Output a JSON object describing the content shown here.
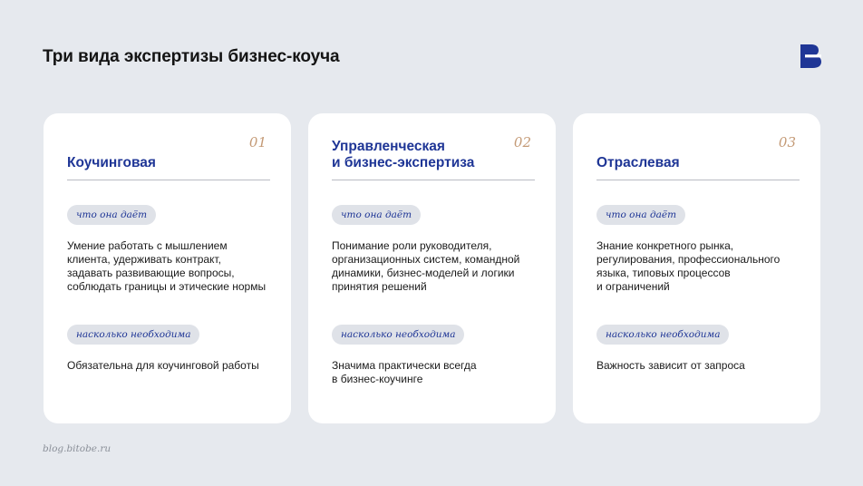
{
  "title": "Три вида экспертизы бизнес-коуча",
  "footer": "blog.bitobe.ru",
  "colors": {
    "accent": "#1f3696",
    "number": "#c49a76",
    "pill": "#dfe2e8",
    "background": "#e6e9ee"
  },
  "cards": [
    {
      "number": "01",
      "title": "Коучинговая",
      "label_what": "что она даёт",
      "what": "Умение работать с мышлением\nклиента, удерживать контракт,\nзадавать развивающие вопросы,\nсоблюдать границы и этические нормы",
      "label_need": "насколько необходима",
      "need": "Обязательна для коучинговой работы"
    },
    {
      "number": "02",
      "title": "Управленческая\nи бизнес-экспертиза",
      "label_what": "что она даёт",
      "what": "Понимание роли руководителя,\nорганизационных систем, командной\nдинамики, бизнес-моделей и логики\nпринятия решений",
      "label_need": "насколько необходима",
      "need": "Значима практически всегда\nв бизнес-коучинге"
    },
    {
      "number": "03",
      "title": "Отраслевая",
      "label_what": "что она даёт",
      "what": "Знание конкретного рынка,\nрегулирования, профессионального\nязыка, типовых процессов\nи ограничений",
      "label_need": "насколько необходима",
      "need": "Важность зависит от запроса"
    }
  ]
}
